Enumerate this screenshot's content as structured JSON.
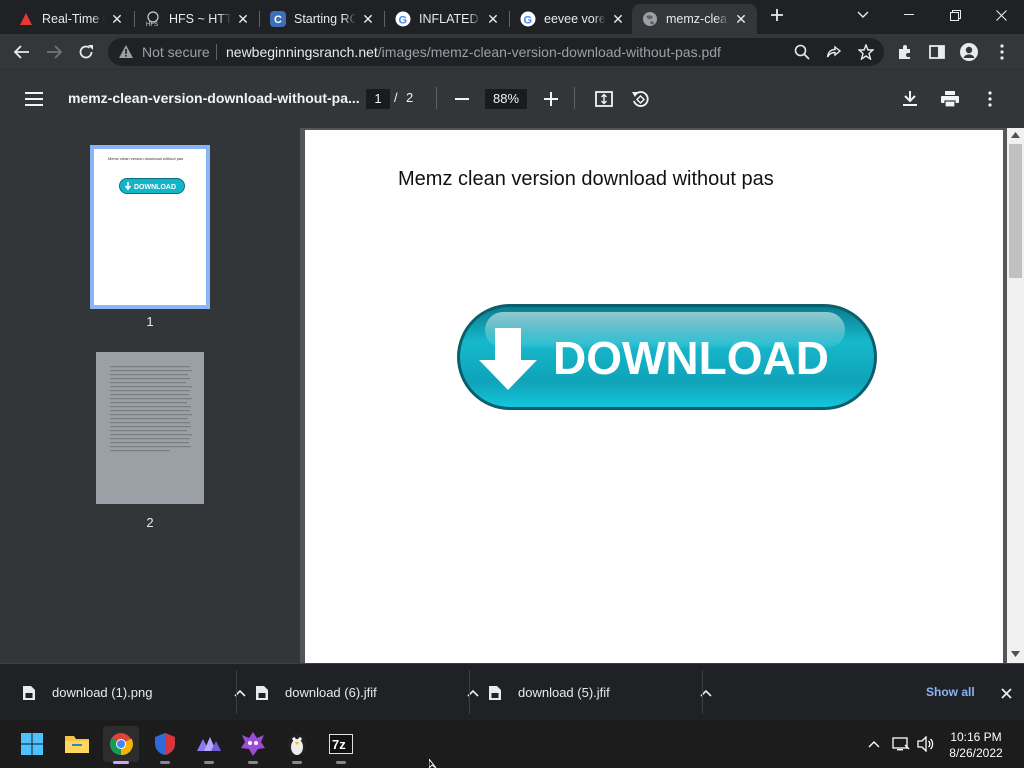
{
  "tabs": [
    {
      "title": "Real-Time C",
      "favicon": "red-triangle-icon"
    },
    {
      "title": "HFS ~ HTTP",
      "favicon": "hfs-icon"
    },
    {
      "title": "Starting RO",
      "favicon": "c-logo-icon"
    },
    {
      "title": "INFLATED E",
      "favicon": "google-icon"
    },
    {
      "title": "eevee vore",
      "favicon": "google-icon"
    },
    {
      "title": "memz-clea",
      "favicon": "globe-icon",
      "active": true
    }
  ],
  "omnibox": {
    "security_label": "Not secure",
    "host": "newbeginningsranch.net",
    "path": "/images/memz-clean-version-download-without-pas.pdf"
  },
  "pdf_viewer": {
    "file_title": "memz-clean-version-download-without-pa...",
    "current_page": "1",
    "page_separator": "/",
    "total_pages": "2",
    "zoom": "88%",
    "thumbnail_labels": [
      "1",
      "2"
    ],
    "thumb_text": "Memz clean version download without pas",
    "page_title": "Memz clean version download without pas",
    "download_button_text": "DOWNLOAD",
    "thumb_button_text": "DOWNLOAD"
  },
  "downloads": [
    {
      "name": "download (1).png"
    },
    {
      "name": "download (6).jfif"
    },
    {
      "name": "download (5).jfif"
    }
  ],
  "show_all_label": "Show all",
  "taskbar": {
    "apps": [
      "windows-start-icon",
      "file-explorer-icon",
      "chrome-icon",
      "shield-app-icon",
      "triangles-app-icon",
      "purple-creature-app-icon",
      "tux-app-icon",
      "sevenzip-icon"
    ],
    "time": "10:16 PM",
    "date": "8/26/2022"
  },
  "colors": {
    "accent": "#8ab4f8",
    "download_cyan": "#14b5c8",
    "pdf_bar": "#323639"
  }
}
